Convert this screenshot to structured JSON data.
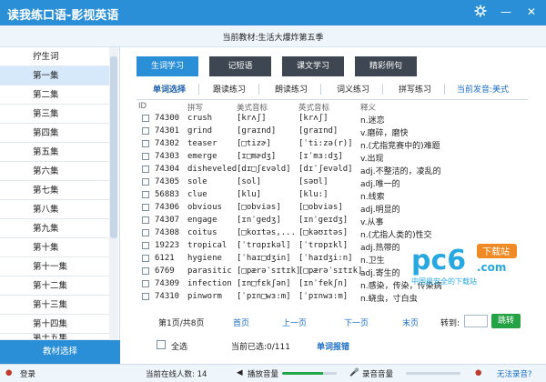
{
  "window": {
    "title": "读我练口语-影视英语",
    "settings_icon": "gear-icon",
    "minimize": "—",
    "close": "✕"
  },
  "course": {
    "label": "当前教材:生活大爆炸第五季"
  },
  "sidebar": {
    "items": [
      {
        "label": "拧生词"
      },
      {
        "label": "第一集"
      },
      {
        "label": "第二集"
      },
      {
        "label": "第三集"
      },
      {
        "label": "第四集"
      },
      {
        "label": "第五集"
      },
      {
        "label": "第六集"
      },
      {
        "label": "第七集"
      },
      {
        "label": "第八集"
      },
      {
        "label": "第九集"
      },
      {
        "label": "第十集"
      },
      {
        "label": "第十一集"
      },
      {
        "label": "第十二集"
      },
      {
        "label": "第十三集"
      },
      {
        "label": "第十四集"
      },
      {
        "label": "第十五集"
      }
    ],
    "select_button": "教材选择"
  },
  "main_tabs": [
    {
      "label": "生词学习"
    },
    {
      "label": "记短语"
    },
    {
      "label": "课文学习"
    },
    {
      "label": "精彩例句"
    }
  ],
  "sub_tabs": [
    {
      "label": "单词选择"
    },
    {
      "label": "跟读练习"
    },
    {
      "label": "朗读练习"
    },
    {
      "label": "词义练习"
    },
    {
      "label": "拼写练习"
    }
  ],
  "accent": {
    "label": "当前发音:美式"
  },
  "table": {
    "headers": {
      "id": "ID",
      "spelling": "拼写",
      "us": "美式音标",
      "uk": "英式音标",
      "meaning": "释义"
    },
    "rows": [
      {
        "id": "74300",
        "word": "crush",
        "us": "[krʌʃ]",
        "uk": "[krʌʃ]",
        "meaning": "n.迷恋"
      },
      {
        "id": "74301",
        "word": "grind",
        "us": "[graɪnd]",
        "uk": "[graɪnd]",
        "meaning": "v.磨碎，磨快"
      },
      {
        "id": "74302",
        "word": "teaser",
        "us": "[□tizɚ]",
        "uk": "[ˈti:zə(r)]",
        "meaning": "n.(尤指竞赛中的)难题"
      },
      {
        "id": "74303",
        "word": "emerge",
        "us": "[ɪ□mɚdʒ]",
        "uk": "[ɪˈmɜ:dʒ]",
        "meaning": "v.出现"
      },
      {
        "id": "74304",
        "word": "disheveled",
        "us": "[dɪ□ʃɛvəld]",
        "uk": "[dɪˈʃevəld]",
        "meaning": "adj.不整洁的，凌乱的"
      },
      {
        "id": "74305",
        "word": "sole",
        "us": "[sol]",
        "uk": "[səʊl]",
        "meaning": "adj.唯一的"
      },
      {
        "id": "56883",
        "word": "clue",
        "us": "[klu]",
        "uk": "[klu:]",
        "meaning": "n.线索"
      },
      {
        "id": "74306",
        "word": "obvious",
        "us": "[□obviəs]",
        "uk": "[□obviəs]",
        "meaning": "adj.明显的"
      },
      {
        "id": "74307",
        "word": "engage",
        "us": "[ɪnˈgedʒ]",
        "uk": "[ɪnˈgeɪdʒ]",
        "meaning": "v.从事"
      },
      {
        "id": "74308",
        "word": "coitus",
        "us": "[□koɪtəs,...",
        "uk": "[□kəʊɪtəs]",
        "meaning": "n.(尤指人类的)性交"
      },
      {
        "id": "19223",
        "word": "tropical",
        "us": "[ˈtrɑpɪkəl]",
        "uk": "[ˈtrɒpɪkl]",
        "meaning": "adj.热带的"
      },
      {
        "id": "6121",
        "word": "hygiene",
        "us": "[ˈhaɪ□dʒin]",
        "uk": "[ˈhaɪdʒi:n]",
        "meaning": "n.卫生"
      },
      {
        "id": "6769",
        "word": "parasitic",
        "us": "[□pærəˈsɪtɪk]",
        "uk": "[□pærəˈsɪtɪk]",
        "meaning": "adj.寄生的"
      },
      {
        "id": "74309",
        "word": "infection",
        "us": "[ɪn□fɛkʃən]",
        "uk": "[ɪnˈfekʃn]",
        "meaning": "n.感染，传染，传染病"
      },
      {
        "id": "74310",
        "word": "pinworm",
        "us": "[ˈpɪn□wɜ:m]",
        "uk": "[ˈpɪnwɜ:m]",
        "meaning": "n.蛲虫，寸白虫"
      }
    ]
  },
  "pager": {
    "info": "第1页/共8页",
    "first": "首页",
    "prev": "上一页",
    "next": "下一页",
    "last": "末页",
    "goto_label": "转到:",
    "go": "跳转"
  },
  "actions": {
    "select_all": "全选",
    "selected": "当前已选:0/111",
    "report": "单词报错"
  },
  "status": {
    "login": "登录",
    "online": "当前在线人数: 14",
    "play_volume": "播放音量",
    "record_volume": "录音音量",
    "no_voice": "无法录音?",
    "play_volume_level": 0.75,
    "record_volume_level": 0.0
  },
  "watermark": {
    "brand": "pc6",
    "tag": "下载站",
    "domain": ".com",
    "slogan": "中国最安全的下载站",
    "accent_color": "#27a8e0"
  }
}
